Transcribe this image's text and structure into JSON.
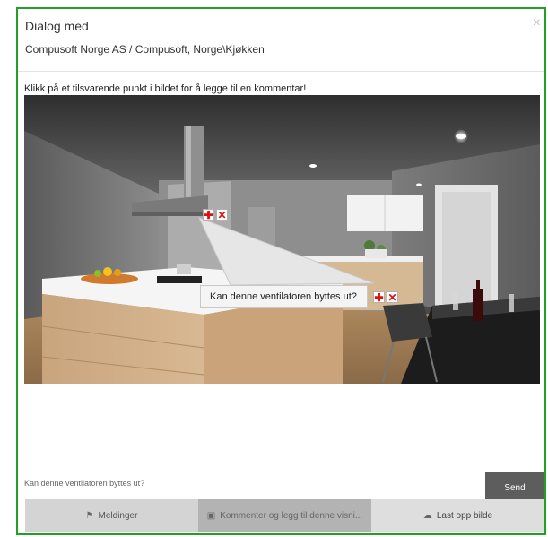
{
  "dialog": {
    "title": "Dialog med",
    "subtitle": "Compusoft Norge AS / Compusoft, Norge\\Kjøkken",
    "close_icon": "×"
  },
  "image_panel": {
    "instruction": "Klikk på et tilsvarende punkt i bildet for å legge til en kommentar!",
    "markers": [
      {
        "add_glyph": "✚",
        "delete_glyph": "✕"
      },
      {
        "add_glyph": "✚",
        "delete_glyph": "✕"
      }
    ],
    "callout_text": "Kan denne ventilatoren byttes ut?"
  },
  "comment": {
    "placeholder": "Kan denne ventilatoren byttes ut?",
    "send_label": "Send"
  },
  "tabs": [
    {
      "label": "Meldinger",
      "icon": "flag-icon",
      "glyph": "⚑"
    },
    {
      "label": "Kommenter og legg til denne visni...",
      "icon": "image-icon",
      "glyph": "▣"
    },
    {
      "label": "Last opp bilde",
      "icon": "cloud-upload-icon",
      "glyph": "☁"
    }
  ],
  "colors": {
    "frame_border": "#22a022",
    "send_button": "#5d5d5d",
    "marker_icon": "#dd1111"
  }
}
